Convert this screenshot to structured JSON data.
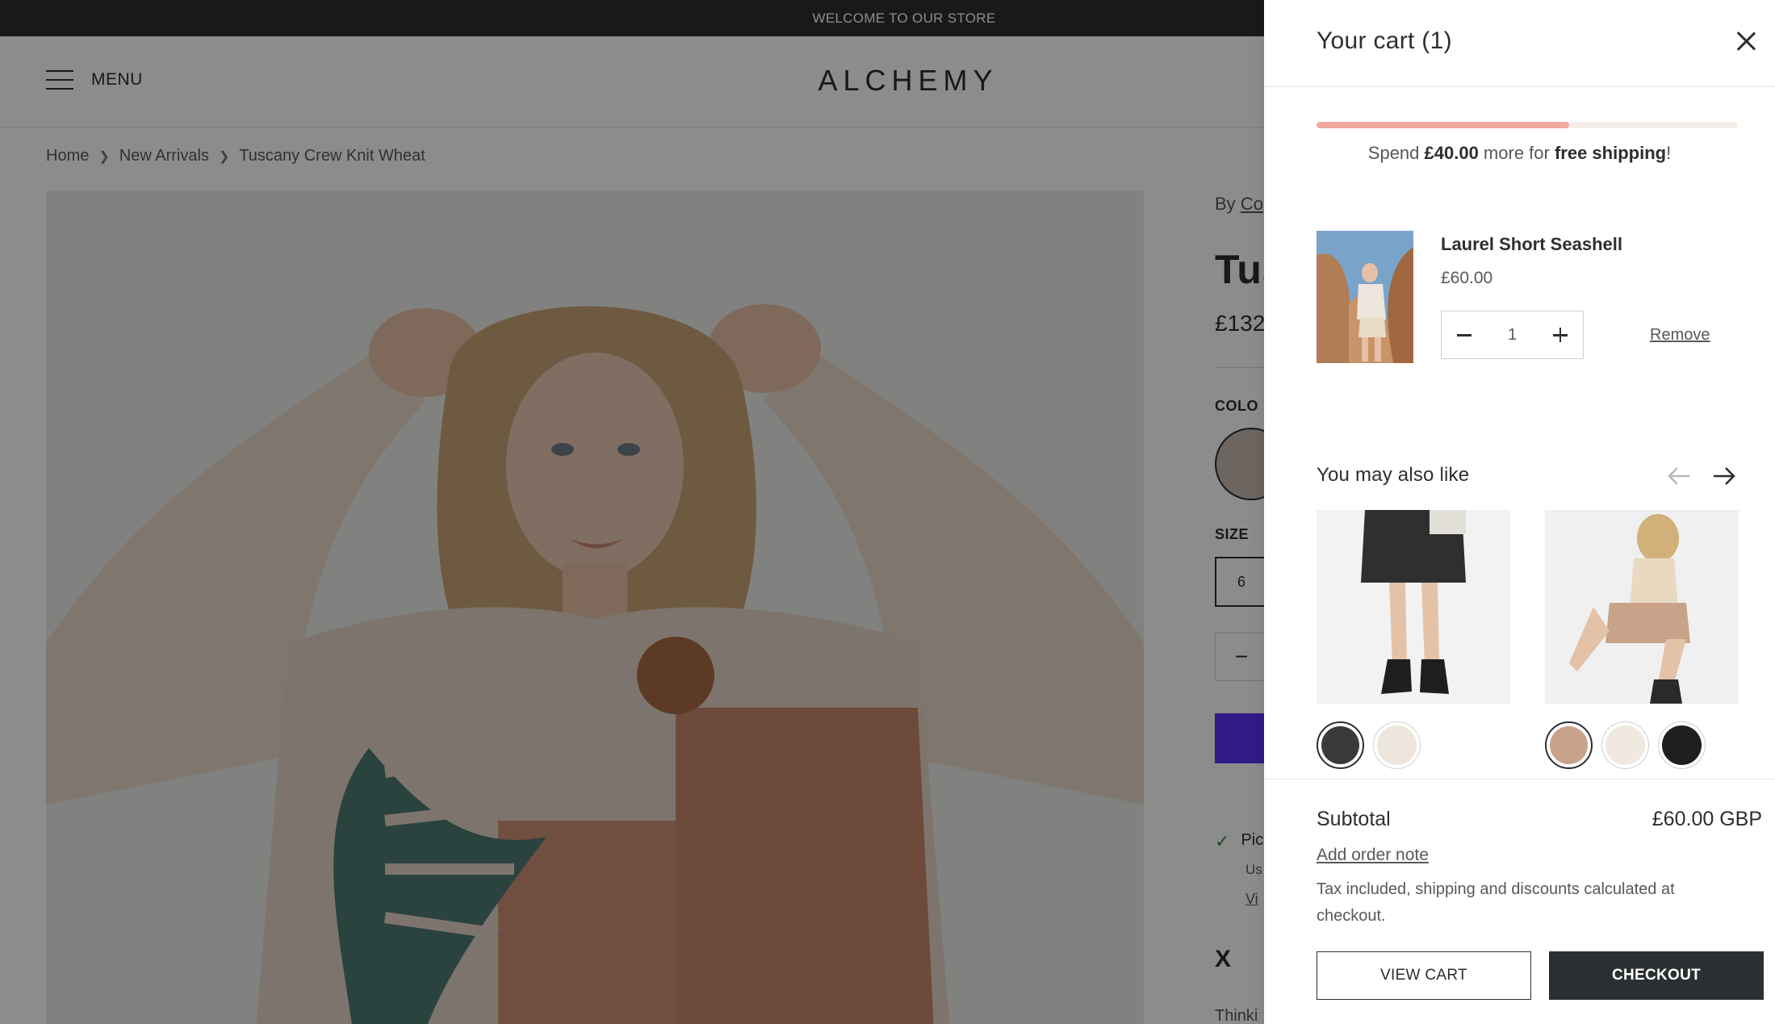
{
  "announcement": "WELCOME TO OUR STORE",
  "header": {
    "menu_label": "MENU",
    "logo": "ALCHEMY"
  },
  "breadcrumb": [
    "Home",
    "New Arrivals",
    "Tuscany Crew Knit Wheat"
  ],
  "product": {
    "vendor_prefix": "By",
    "vendor": "Co",
    "title": "Tus",
    "price": "£132",
    "color_label": "COLO",
    "size_label": "SIZE",
    "size_value": "6",
    "qty_minus": "−",
    "pickup_text": "Pic",
    "pickup_sub": "Us",
    "pickup_link": "Vi",
    "share_icon": "X",
    "thinking_text": "Thinki"
  },
  "cart": {
    "title": "Your cart (1)",
    "shipping": {
      "progress_fraction": 0.6,
      "prefix": "Spend ",
      "amount": "£40.00",
      "middle": " more for ",
      "emphasis": "free shipping",
      "suffix": "!",
      "fill_color": "#f2a7a0",
      "track_color": "#f4ede8"
    },
    "item": {
      "name": "Laurel Short Seashell",
      "price": "£60.00",
      "quantity": "1",
      "remove_label": "Remove"
    },
    "recommendations": {
      "title": "You may also like",
      "products": [
        {
          "name": "black-mini-skirt",
          "swatch_count": 2
        },
        {
          "name": "check-shorts",
          "swatch_count": 3
        }
      ]
    },
    "footer": {
      "subtotal_label": "Subtotal",
      "subtotal_value": "£60.00 GBP",
      "order_note_label": "Add order note",
      "tax_note": "Tax included, shipping and discounts calculated at checkout.",
      "view_cart_label": "VIEW CART",
      "checkout_label": "CHECKOUT"
    }
  },
  "colors": {
    "dark": "#2b2f31",
    "accent_purple": "#5a31f4",
    "overlay": "rgba(0,0,0,0.45)"
  },
  "icons": [
    "hamburger-icon",
    "chevron-right-icon",
    "close-icon",
    "minus-icon",
    "plus-icon",
    "arrow-left-icon",
    "arrow-right-icon",
    "check-icon",
    "x-social-icon"
  ]
}
